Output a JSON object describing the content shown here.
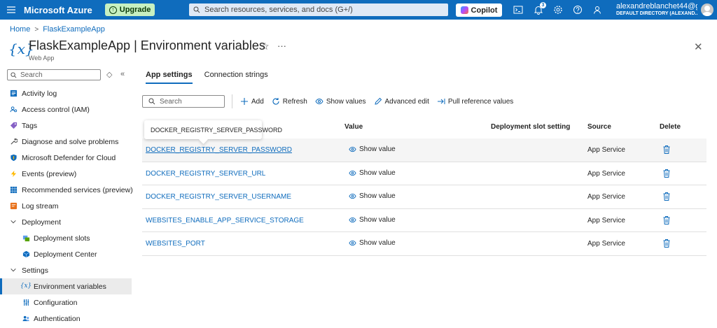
{
  "topbar": {
    "brand": "Microsoft Azure",
    "upgrade_label": "Upgrade",
    "search_placeholder": "Search resources, services, and docs (G+/)",
    "copilot_label": "Copilot",
    "notification_count": "3",
    "account_email": "alexandreblanchet44@g...",
    "account_directory": "DEFAULT DIRECTORY (ALEXAND..."
  },
  "breadcrumb": {
    "home": "Home",
    "app": "FlaskExampleApp"
  },
  "header": {
    "icon_text": "{x}",
    "title": "FlaskExampleApp | Environment variables",
    "subtitle": "Web App"
  },
  "sidebar": {
    "search_placeholder": "Search",
    "items": [
      {
        "label": "Activity log",
        "icon": "activity-log-icon"
      },
      {
        "label": "Access control (IAM)",
        "icon": "iam-icon"
      },
      {
        "label": "Tags",
        "icon": "tag-icon"
      },
      {
        "label": "Diagnose and solve problems",
        "icon": "wrench-icon"
      },
      {
        "label": "Microsoft Defender for Cloud",
        "icon": "shield-icon"
      },
      {
        "label": "Events (preview)",
        "icon": "lightning-icon"
      },
      {
        "label": "Recommended services (preview)",
        "icon": "grid-icon"
      },
      {
        "label": "Log stream",
        "icon": "log-stream-icon"
      },
      {
        "label": "Deployment",
        "icon": "chevron-down-icon"
      },
      {
        "label": "Deployment slots",
        "icon": "deployment-slots-icon"
      },
      {
        "label": "Deployment Center",
        "icon": "cube-icon"
      },
      {
        "label": "Settings",
        "icon": "chevron-down-icon"
      },
      {
        "label": "Environment variables",
        "icon": "variable-icon"
      },
      {
        "label": "Configuration",
        "icon": "sliders-icon"
      },
      {
        "label": "Authentication",
        "icon": "people-icon"
      }
    ]
  },
  "tabs": [
    {
      "label": "App settings",
      "active": true
    },
    {
      "label": "Connection strings",
      "active": false
    }
  ],
  "toolbar": {
    "search_placeholder": "Search",
    "add": "Add",
    "refresh": "Refresh",
    "show_values": "Show values",
    "advanced_edit": "Advanced edit",
    "pull_reference": "Pull reference values"
  },
  "tooltip": "DOCKER_REGISTRY_SERVER_PASSWORD",
  "table": {
    "headers": {
      "value": "Value",
      "slot": "Deployment slot setting",
      "source": "Source",
      "delete": "Delete"
    },
    "rows": [
      {
        "name": "DOCKER_REGISTRY_SERVER_PASSWORD",
        "value": "Show value",
        "source": "App Service"
      },
      {
        "name": "DOCKER_REGISTRY_SERVER_URL",
        "value": "Show value",
        "source": "App Service"
      },
      {
        "name": "DOCKER_REGISTRY_SERVER_USERNAME",
        "value": "Show value",
        "source": "App Service"
      },
      {
        "name": "WEBSITES_ENABLE_APP_SERVICE_STORAGE",
        "value": "Show value",
        "source": "App Service"
      },
      {
        "name": "WEBSITES_PORT",
        "value": "Show value",
        "source": "App Service"
      }
    ]
  },
  "colors": {
    "accent": "#0f6cbd",
    "upgrade_bg": "#c7f0c1",
    "selected_bg": "#ebebeb"
  }
}
